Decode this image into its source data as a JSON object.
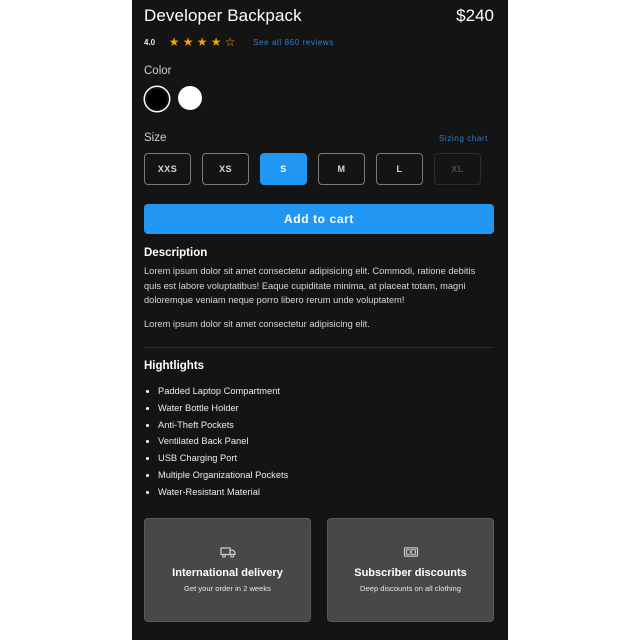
{
  "product": {
    "title": "Developer Backpack",
    "price": "$240",
    "rating": "4.0",
    "stars_filled": 4,
    "stars_total": 5,
    "reviews_link": "See all 860 reviews"
  },
  "color": {
    "label": "Color",
    "options": [
      {
        "name": "black",
        "hex": "#000000",
        "selected": true
      },
      {
        "name": "white",
        "hex": "#ffffff",
        "selected": false
      }
    ]
  },
  "size": {
    "label": "Size",
    "sizing_chart_link": "Sizing chart",
    "options": [
      {
        "label": "XXS",
        "state": "default"
      },
      {
        "label": "XS",
        "state": "default"
      },
      {
        "label": "S",
        "state": "selected"
      },
      {
        "label": "M",
        "state": "default"
      },
      {
        "label": "L",
        "state": "default"
      },
      {
        "label": "XL",
        "state": "disabled"
      }
    ]
  },
  "cart": {
    "label": "Add to cart"
  },
  "description": {
    "heading": "Description",
    "paragraphs": [
      "Lorem ipsum dolor sit amet consectetur adipisicing elit. Commodi, ratione debitis quis est labore voluptatibus! Eaque cupiditate minima, at placeat totam, magni doloremque veniam neque porro libero rerum unde voluptatem!",
      "Lorem ipsum dolor sit amet consectetur adipisicing elit."
    ]
  },
  "highlights": {
    "heading": "Hightlights",
    "items": [
      "Padded Laptop Compartment",
      "Water Bottle Holder",
      "Anti-Theft Pockets",
      "Ventilated Back Panel",
      "USB Charging Port",
      "Multiple Organizational Pockets",
      "Water-Resistant Material"
    ]
  },
  "cards": [
    {
      "icon": "truck-icon",
      "title": "International delivery",
      "subtitle": "Get your order in 2 weeks"
    },
    {
      "icon": "cash-icon",
      "title": "Subscriber discounts",
      "subtitle": "Deep discounts on all clothing"
    }
  ],
  "colors": {
    "panel_bg": "#141414",
    "accent": "#2196f3",
    "link": "#2f7fd1",
    "star": "#f59e0b",
    "card_bg": "#484848"
  }
}
